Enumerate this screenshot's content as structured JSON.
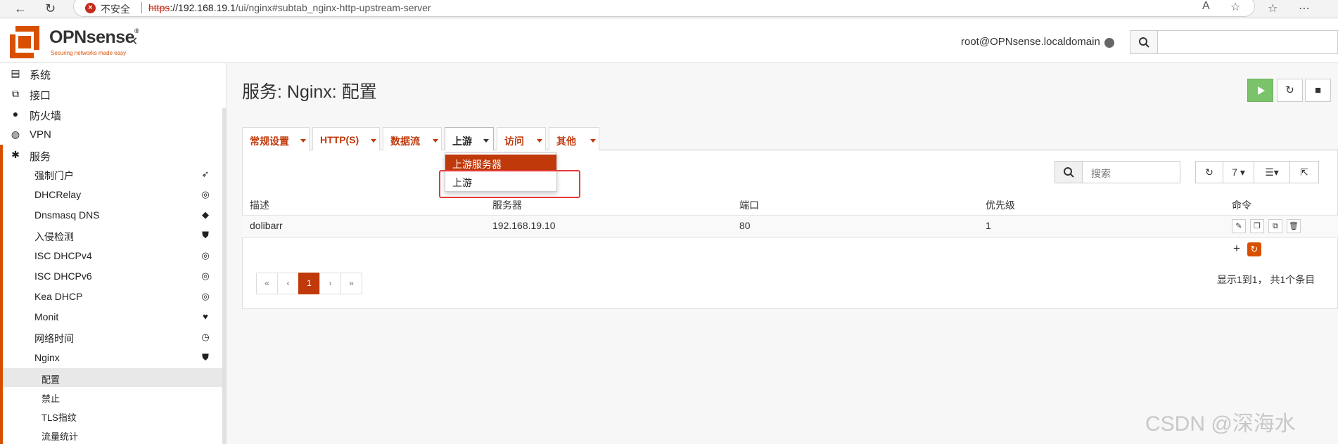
{
  "browser": {
    "warning": "不安全",
    "url_proto": "https",
    "url_host": "://192.168.19.1",
    "url_rest": "/ui/nginx#subtab_nginx-http-upstream-server"
  },
  "header": {
    "logo_text": "OPNsense",
    "logo_reg": "®",
    "logo_tagline": "Securing networks made easy",
    "user": "root@OPNsense.localdomain"
  },
  "sidebar": {
    "top_items": [
      {
        "label": "系统",
        "icon": "server-icon"
      },
      {
        "label": "接口",
        "icon": "sitemap-icon"
      },
      {
        "label": "防火墙",
        "icon": "fire-icon"
      },
      {
        "label": "VPN",
        "icon": "globe-icon"
      },
      {
        "label": "服务",
        "icon": "cog-icon"
      }
    ],
    "services": [
      {
        "label": "强制门户",
        "icon": "paper-plane-icon"
      },
      {
        "label": "DHCRelay",
        "icon": "bullseye-icon"
      },
      {
        "label": "Dnsmasq DNS",
        "icon": "tags-icon"
      },
      {
        "label": "入侵检测",
        "icon": "shield-icon"
      },
      {
        "label": "ISC DHCPv4",
        "icon": "bullseye-icon"
      },
      {
        "label": "ISC DHCPv6",
        "icon": "bullseye-icon"
      },
      {
        "label": "Kea DHCP",
        "icon": "bullseye-icon"
      },
      {
        "label": "Monit",
        "icon": "heartbeat-icon"
      },
      {
        "label": "网络时间",
        "icon": "clock-icon"
      },
      {
        "label": "Nginx",
        "icon": "shield-icon"
      }
    ],
    "nginx_sub": [
      {
        "label": "配置",
        "selected": true
      },
      {
        "label": "禁止",
        "selected": false
      },
      {
        "label": "TLS指纹",
        "selected": false
      },
      {
        "label": "流量统计",
        "selected": false
      }
    ]
  },
  "main": {
    "title": "服务: Nginx: 配置",
    "tabs": [
      {
        "label": "常规设置"
      },
      {
        "label": "HTTP(S)"
      },
      {
        "label": "数据流"
      },
      {
        "label": "上游",
        "active": true
      },
      {
        "label": "访问"
      },
      {
        "label": "其他"
      }
    ],
    "dropdown": [
      "上游服务器",
      "上游"
    ],
    "search_placeholder": "搜索",
    "page_size": "7",
    "columns": [
      "描述",
      "服务器",
      "端口",
      "优先级",
      "命令"
    ],
    "rows": [
      {
        "desc": "dolibarr",
        "server": "192.168.19.10",
        "port": "80",
        "priority": "1"
      }
    ],
    "pagination": [
      "«",
      "‹",
      "1",
      "›",
      "»"
    ],
    "info": "显示1到1， 共1个条目"
  },
  "colors": {
    "accent": "#d94f00",
    "tab_text": "#c0390b",
    "play": "#7ac36a"
  },
  "watermark": "CSDN @深海水"
}
